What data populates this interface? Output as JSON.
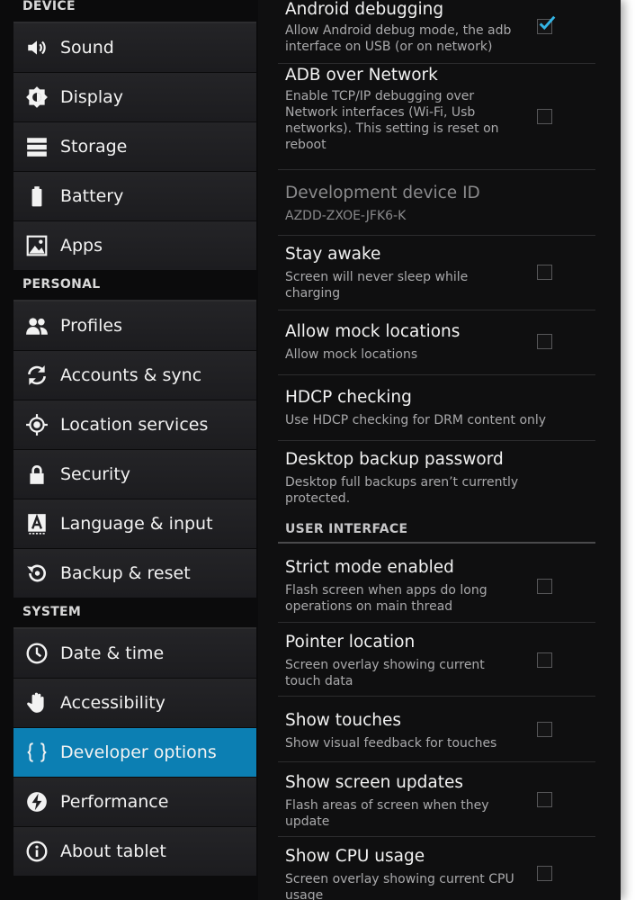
{
  "sidebar": {
    "categories": {
      "device": "DEVICE",
      "personal": "PERSONAL",
      "system": "SYSTEM"
    },
    "items": [
      {
        "label": "Sound",
        "icon": "speaker-icon"
      },
      {
        "label": "Display",
        "icon": "brightness-icon"
      },
      {
        "label": "Storage",
        "icon": "storage-icon"
      },
      {
        "label": "Battery",
        "icon": "battery-icon"
      },
      {
        "label": "Apps",
        "icon": "apps-icon"
      },
      {
        "label": "Profiles",
        "icon": "profiles-icon"
      },
      {
        "label": "Accounts & sync",
        "icon": "sync-icon"
      },
      {
        "label": "Location services",
        "icon": "location-icon"
      },
      {
        "label": "Security",
        "icon": "lock-icon"
      },
      {
        "label": "Language & input",
        "icon": "keyboard-letter-icon"
      },
      {
        "label": "Backup & reset",
        "icon": "backup-icon"
      },
      {
        "label": "Date & time",
        "icon": "clock-icon"
      },
      {
        "label": "Accessibility",
        "icon": "hand-icon"
      },
      {
        "label": "Developer options",
        "icon": "braces-icon",
        "selected": true
      },
      {
        "label": "Performance",
        "icon": "lightning-icon"
      },
      {
        "label": "About tablet",
        "icon": "info-icon"
      }
    ],
    "active_color": "#0c7fb3"
  },
  "panel": {
    "section_ui": "USER INTERFACE",
    "settings": [
      {
        "title": "Android debugging",
        "summary": "Allow Android debug mode, the adb interface on USB (or on network)",
        "checkbox": true,
        "checked": true
      },
      {
        "title": "ADB over Network",
        "summary": "Enable TCP/IP debugging over Network interfaces (Wi-Fi, Usb networks). This setting is reset on reboot",
        "checkbox": true,
        "checked": false
      },
      {
        "title": "Development device ID",
        "summary": "AZDD-ZXOE-JFK6-K",
        "checkbox": false
      },
      {
        "title": "Stay awake",
        "summary": "Screen will never sleep while charging",
        "checkbox": true,
        "checked": false
      },
      {
        "title": "Allow mock locations",
        "summary": "Allow mock locations",
        "checkbox": true,
        "checked": false
      },
      {
        "title": "HDCP checking",
        "summary": "Use HDCP checking for DRM content only",
        "checkbox": false
      },
      {
        "title": "Desktop backup password",
        "summary": "Desktop full backups aren’t currently protected.",
        "checkbox": false
      },
      {
        "title": "Strict mode enabled",
        "summary": "Flash screen when apps do long operations on main thread",
        "checkbox": true,
        "checked": false
      },
      {
        "title": "Pointer location",
        "summary": "Screen overlay showing current touch data",
        "checkbox": true,
        "checked": false
      },
      {
        "title": "Show touches",
        "summary": "Show visual feedback for touches",
        "checkbox": true,
        "checked": false
      },
      {
        "title": "Show screen updates",
        "summary": "Flash areas of screen when they update",
        "checkbox": true,
        "checked": false
      },
      {
        "title": "Show CPU usage",
        "summary": "Screen overlay showing current CPU usage",
        "checkbox": true,
        "checked": false
      }
    ],
    "check_color": "#33b5e5"
  }
}
